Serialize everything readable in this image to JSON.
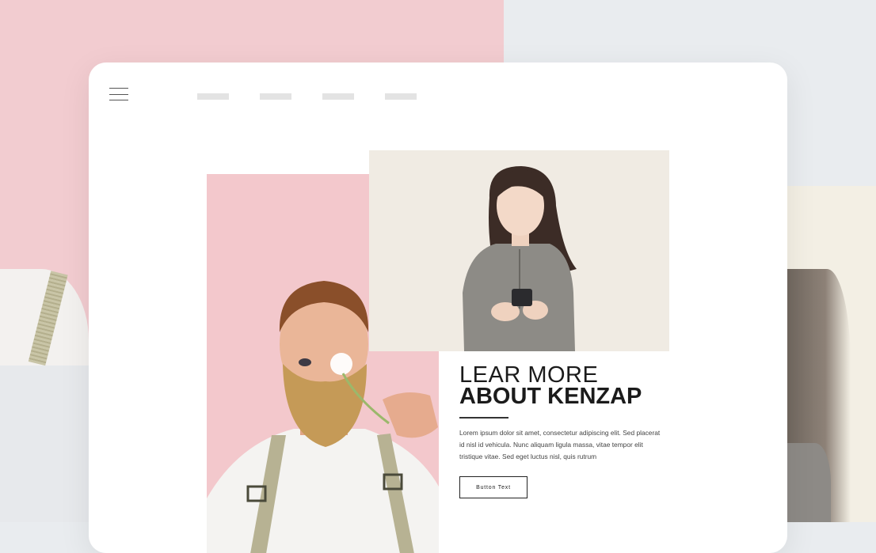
{
  "nav": {
    "menu_icon": "hamburger-icon",
    "items": [
      "",
      "",
      "",
      ""
    ]
  },
  "hero": {
    "heading_line1": "LEAR MORE",
    "heading_line2": "ABOUT KENZAP",
    "body": "Lorem ipsum dolor sit amet, consectetur adipiscing elit. Sed placerat id nisl id vehicula. Nunc aliquam ligula massa, vitae tempor elit tristique vitae. Sed eget luctus nisl, quis rutrum",
    "button_label": "Button Text"
  },
  "images": {
    "man": "bearded-man-with-dandelion-photo",
    "woman": "woman-holding-phone-photo"
  },
  "colors": {
    "pink": "#f2ccd0",
    "cream": "#f0ebe3",
    "background": "#e9ecef",
    "text": "#1b1b1b"
  }
}
